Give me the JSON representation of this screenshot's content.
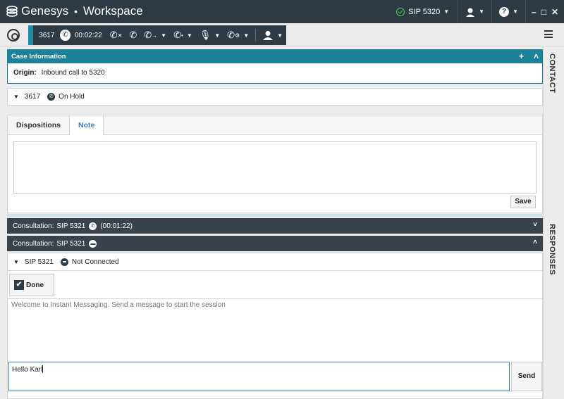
{
  "titlebar": {
    "brand": "Genesys",
    "app": "Workspace",
    "agent_status": "SIP 5320",
    "window_controls": [
      "–",
      "□",
      "✕"
    ]
  },
  "callbar": {
    "number": "3617",
    "timer": "00:02:22"
  },
  "sidebar": {
    "contact_tab": "CONTACT",
    "responses_tab": "RESPONSES"
  },
  "case": {
    "header": "Case Information",
    "origin_label": "Origin:",
    "origin_value": "Inbound call to 5320"
  },
  "party": {
    "number": "3617",
    "status": "On Hold"
  },
  "tabs": {
    "dispositions": "Dispositions",
    "note": "Note"
  },
  "note": {
    "save_label": "Save"
  },
  "consultation1": {
    "label": "Consultation:",
    "target": "SIP 5321",
    "duration": "(00:01:22)"
  },
  "consultation2": {
    "label": "Consultation:",
    "target": "SIP 5321"
  },
  "im": {
    "party": "SIP 5321",
    "status": "Not Connected",
    "done_label": "Done",
    "welcome": "Welcome to Instant Messaging. Send a message to start the session",
    "compose_value": "Hello Karl",
    "send_label": "Send"
  },
  "colors": {
    "titlebar": "#2f3b44",
    "accent": "#1d8299",
    "link": "#3a7fc1"
  }
}
